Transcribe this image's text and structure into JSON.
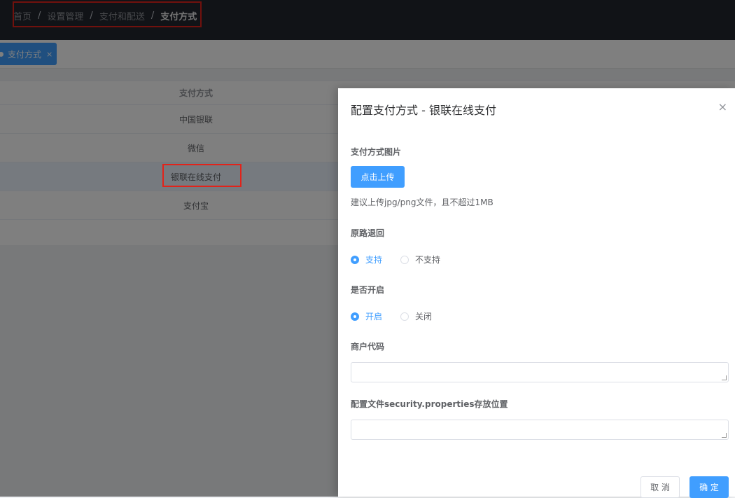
{
  "breadcrumb": {
    "items": [
      "首页",
      "设置管理",
      "支付和配送"
    ],
    "current": "支付方式",
    "separator": "/"
  },
  "tabs": [
    {
      "label": "支付方式",
      "close": "×"
    }
  ],
  "table": {
    "header": "支付方式",
    "rows": [
      "中国银联",
      "微信",
      "银联在线支付",
      "支付宝"
    ]
  },
  "drawer": {
    "title": "配置支付方式 - 银联在线支付",
    "close": "×",
    "image_label": "支付方式图片",
    "upload_button": "点击上传",
    "upload_tip": "建议上传jpg/png文件，且不超过1MB",
    "refund_label": "原路退回",
    "refund_options": [
      "支持",
      "不支持"
    ],
    "enabled_label": "是否开启",
    "enabled_options": [
      "开启",
      "关闭"
    ],
    "merchant_label": "商户代码",
    "merchant_value": "",
    "config_label": "配置文件security.properties存放位置",
    "config_value": "",
    "cancel": "取 消",
    "confirm": "确 定"
  },
  "colors": {
    "primary": "#409eff",
    "header_bg": "#23262e",
    "highlight": "#e2231a"
  }
}
